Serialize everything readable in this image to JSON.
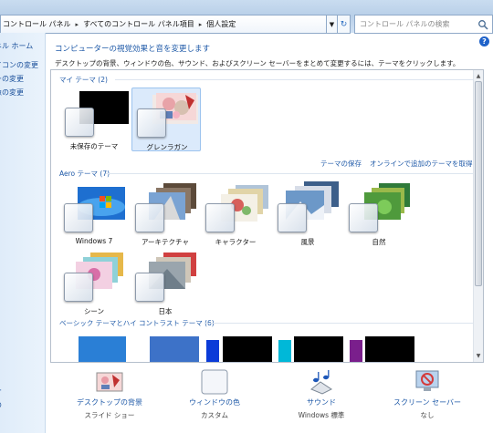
{
  "address": {
    "crumbs": [
      "コントロール パネル",
      "すべてのコントロール パネル項目",
      "個人設定"
    ],
    "separator": "▸",
    "search_placeholder": "コントロール パネルの検索"
  },
  "sidebar": {
    "items": [
      {
        "label": "ネル ホーム"
      },
      {
        "label": "イコンの変更"
      },
      {
        "label": "ーの変更"
      },
      {
        "label": "像の変更"
      }
    ],
    "bottom_items": [
      {
        "label": "ー"
      },
      {
        "label": "の"
      }
    ]
  },
  "main": {
    "title": "コンピューターの視覚効果と音を変更します",
    "description": "デスクトップの背景、ウィンドウの色、サウンド、およびスクリーン セーバーをまとめて変更するには、テーマをクリックします。",
    "groups": [
      {
        "label": "マイ テーマ (2)"
      },
      {
        "label": "Aero テーマ (7)"
      },
      {
        "label": "ベーシック テーマとハイ コントラスト テーマ (6)"
      }
    ],
    "my_themes": [
      {
        "label": "未保存のテーマ",
        "selected": false
      },
      {
        "label": "グレンラガン",
        "selected": true
      }
    ],
    "links": {
      "save": "テーマの保存",
      "online": "オンラインで追加のテーマを取得"
    },
    "aero_themes": [
      {
        "label": "Windows 7"
      },
      {
        "label": "アーキテクチャ"
      },
      {
        "label": "キャラクター"
      },
      {
        "label": "風景"
      },
      {
        "label": "自然"
      },
      {
        "label": "シーン"
      },
      {
        "label": "日本"
      }
    ],
    "basic_colors": [
      "#2a7fd6",
      "#3d72c8",
      "#0b3bd8",
      "#00b8d8",
      "#7a1f8c",
      "#000000"
    ]
  },
  "bottom": {
    "items": [
      {
        "title": "デスクトップの背景",
        "sub": "スライド ショー",
        "icon": "desktop-background-icon"
      },
      {
        "title": "ウィンドウの色",
        "sub": "カスタム",
        "icon": "window-color-icon"
      },
      {
        "title": "サウンド",
        "sub": "Windows 標準",
        "icon": "sound-icon"
      },
      {
        "title": "スクリーン セーバー",
        "sub": "なし",
        "icon": "screensaver-icon"
      }
    ]
  },
  "colors": {
    "link": "#1f5aa8",
    "selected_bg": "#dbeafb",
    "nav_bg": "#e4effa"
  }
}
